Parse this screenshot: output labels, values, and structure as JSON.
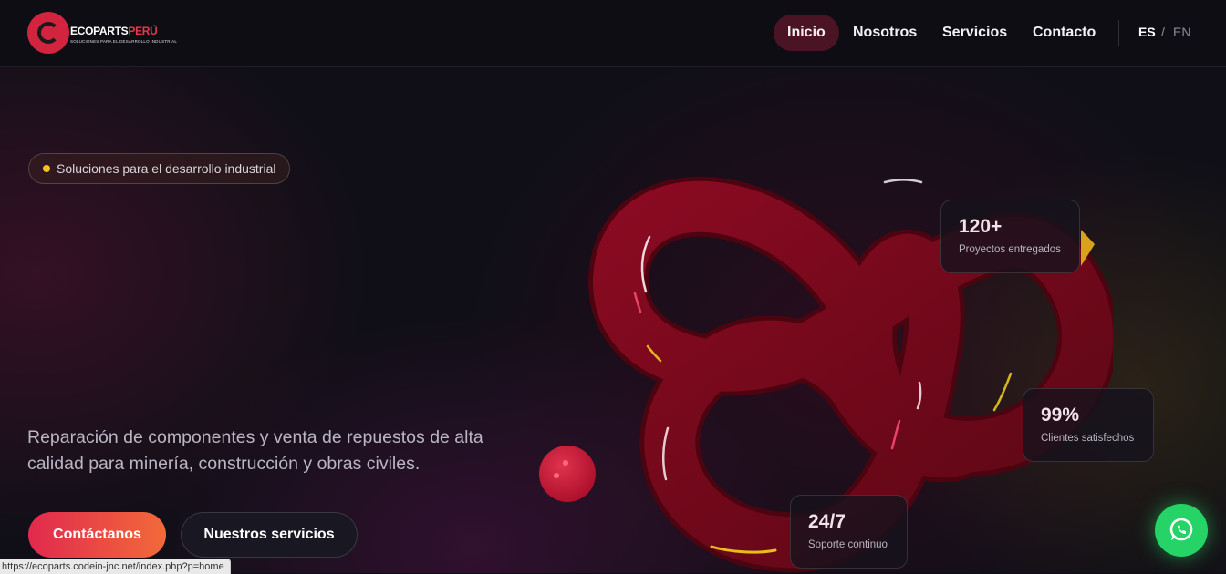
{
  "brand": {
    "name_part1": "ECOPARTS",
    "name_part2": "PERÚ",
    "tagline": "SOLUCIONES PARA EL DESARROLLO INDUSTRIAL",
    "accent_color": "#d2233f"
  },
  "nav": {
    "items": [
      {
        "label": "Inicio",
        "active": true
      },
      {
        "label": "Nosotros",
        "active": false
      },
      {
        "label": "Servicios",
        "active": false
      },
      {
        "label": "Contacto",
        "active": false
      }
    ],
    "lang": {
      "es": "ES",
      "sep": "/",
      "en": "EN",
      "active": "ES"
    }
  },
  "hero": {
    "badge": "Soluciones para el desarrollo industrial",
    "lead": "Reparación de componentes y venta de repuestos de alta calidad para minería, construcción y obras civiles.",
    "cta_primary": "Contáctanos",
    "cta_secondary": "Nuestros servicios"
  },
  "stats": [
    {
      "value": "120+",
      "label": "Proyectos entregados"
    },
    {
      "value": "99%",
      "label": "Clientes satisfechos"
    },
    {
      "value": "24/7",
      "label": "Soporte continuo"
    }
  ],
  "floating": {
    "icon": "whatsapp-icon",
    "color": "#25d366"
  },
  "status_bar": {
    "url": "https://ecoparts.codein-jnc.net/index.php?p=home"
  }
}
